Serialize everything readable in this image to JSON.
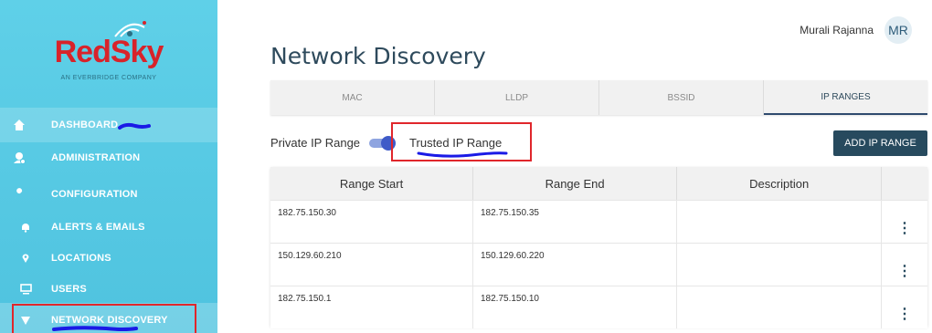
{
  "logo": {
    "text": "RedSky",
    "subtext": "AN EVERBRIDGE COMPANY"
  },
  "sidebar": {
    "items": [
      {
        "label": "DASHBOARD",
        "icon": "home-icon"
      },
      {
        "label": "ADMINISTRATION",
        "icon": "admin-icon"
      },
      {
        "label": "CONFIGURATION",
        "icon": "wrench-icon"
      },
      {
        "label": "ALERTS & EMAILS",
        "icon": "bell-icon"
      },
      {
        "label": "LOCATIONS",
        "icon": "map-pin-icon"
      },
      {
        "label": "USERS",
        "icon": "monitor-icon"
      },
      {
        "label": "NETWORK DISCOVERY",
        "icon": "shield-icon"
      }
    ]
  },
  "header": {
    "user_name": "Murali Rajanna",
    "avatar_initials": "MR",
    "page_title": "Network Discovery"
  },
  "tabs": [
    {
      "label": "MAC"
    },
    {
      "label": "LLDP"
    },
    {
      "label": "BSSID"
    },
    {
      "label": "IP RANGES"
    }
  ],
  "toggle": {
    "left_label": "Private IP Range",
    "right_label": "Trusted IP Range"
  },
  "add_button": {
    "label": "ADD IP RANGE"
  },
  "table": {
    "headers": [
      "Range Start",
      "Range End",
      "Description",
      ""
    ],
    "rows": [
      {
        "start": "182.75.150.30",
        "end": "182.75.150.35",
        "description": ""
      },
      {
        "start": "150.129.60.210",
        "end": "150.129.60.220",
        "description": ""
      },
      {
        "start": "182.75.150.1",
        "end": "182.75.150.10",
        "description": ""
      }
    ]
  },
  "colors": {
    "sidebar": "#5fd0e8",
    "brand_red": "#d8232a",
    "primary_button": "#274a5e",
    "annotation_red": "#e0262b",
    "annotation_blue": "#1a1ae6"
  }
}
